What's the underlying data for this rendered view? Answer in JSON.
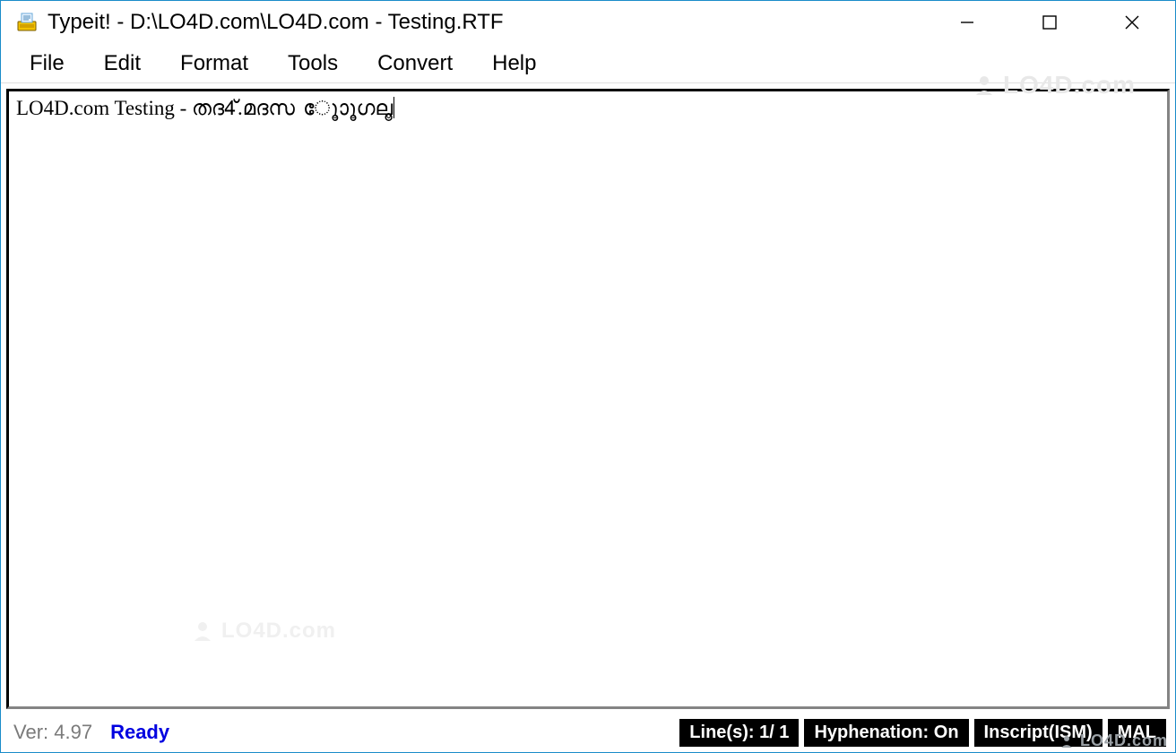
{
  "window": {
    "title": "Typeit! - D:\\LO4D.com\\LO4D.com - Testing.RTF"
  },
  "menu": {
    "items": [
      "File",
      "Edit",
      "Format",
      "Tools",
      "Convert",
      "Help"
    ]
  },
  "editor": {
    "content": "LO4D.com Testing - തദ4്.മദസ ൂോൂഗലൂ"
  },
  "status": {
    "version": "Ver: 4.97",
    "ready": "Ready",
    "lines": "Line(s):  1/ 1",
    "hyphenation": "Hyphenation: On",
    "input_method": "Inscript(ISM)",
    "language": "MAL"
  },
  "watermark": {
    "text": "LO4D.com"
  }
}
